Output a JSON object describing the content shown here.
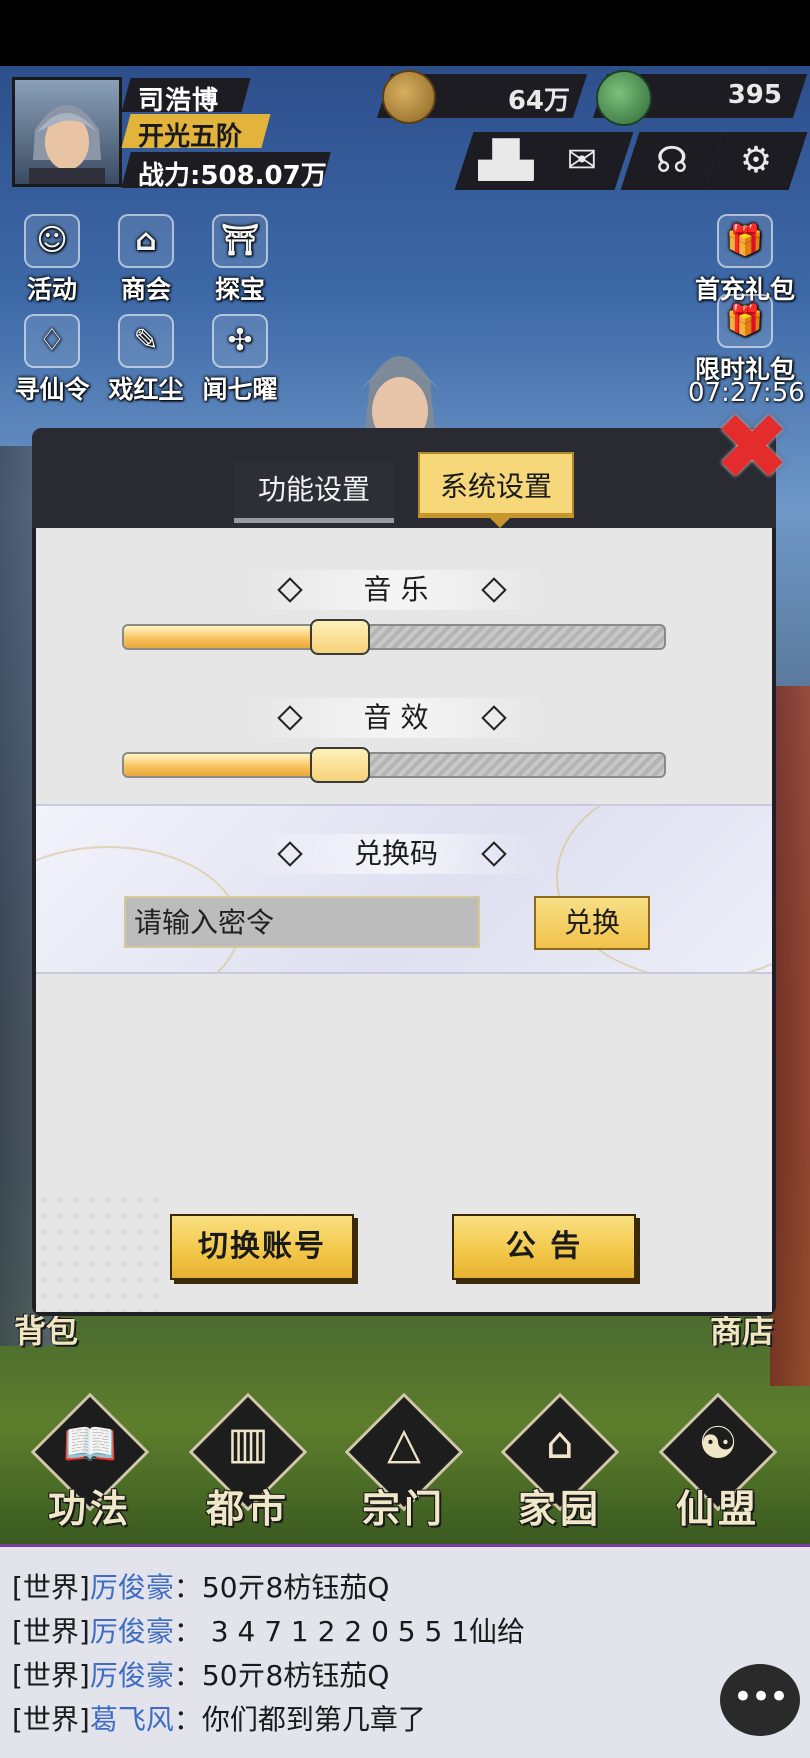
{
  "player": {
    "name": "司浩博",
    "rank": "开光五阶",
    "power": "战力:508.07万"
  },
  "resources": {
    "coins": "64万",
    "jade": "395"
  },
  "top_buttons": [
    "ranking-icon",
    "mail-icon",
    "support-icon",
    "settings-icon"
  ],
  "left_menu": {
    "row1": [
      {
        "label": "活动",
        "icon": "☺"
      },
      {
        "label": "商会",
        "icon": "⌂"
      },
      {
        "label": "探宝",
        "icon": "⛩"
      }
    ],
    "row2": [
      {
        "label": "寻仙令",
        "icon": "♢"
      },
      {
        "label": "戏红尘",
        "icon": "✎"
      },
      {
        "label": "闻七曜",
        "icon": "✣"
      }
    ]
  },
  "right_menu": {
    "first_recharge": "首充礼包",
    "limited_gift": "限时礼包",
    "timer": "07:27:56"
  },
  "dialog": {
    "tab_function": "功能设置",
    "tab_system": "系统设置",
    "music_label": "音 乐",
    "music_level": 0.4,
    "sfx_label": "音 效",
    "sfx_level": 0.4,
    "redeem_label": "兑换码",
    "redeem_placeholder": "请输入密令",
    "redeem_button": "兑换",
    "switch_account": "切换账号",
    "announcement": "公 告"
  },
  "side_labels": {
    "left": "背包",
    "right": "商店"
  },
  "bottom_nav": [
    {
      "label": "功法",
      "icon": "📖"
    },
    {
      "label": "都市",
      "icon": "▥"
    },
    {
      "label": "宗门",
      "icon": "△"
    },
    {
      "label": "家园",
      "icon": "⌂"
    },
    {
      "label": "仙盟",
      "icon": "☯"
    }
  ],
  "chat": [
    {
      "channel": "[世界]",
      "name": "厉俊豪",
      "text": "：50亓8枋钰茄Q"
    },
    {
      "channel": "[世界]",
      "name": "厉俊豪",
      "text": "：  3 4 7  1 2 2  0  5  5  1仙给"
    },
    {
      "channel": "[世界]",
      "name": "厉俊豪",
      "text": "：50亓8枋钰茄Q"
    },
    {
      "channel": "[世界]",
      "name": "葛飞风",
      "text": "：你们都到第几章了"
    }
  ],
  "chat_button_icon": "•••"
}
